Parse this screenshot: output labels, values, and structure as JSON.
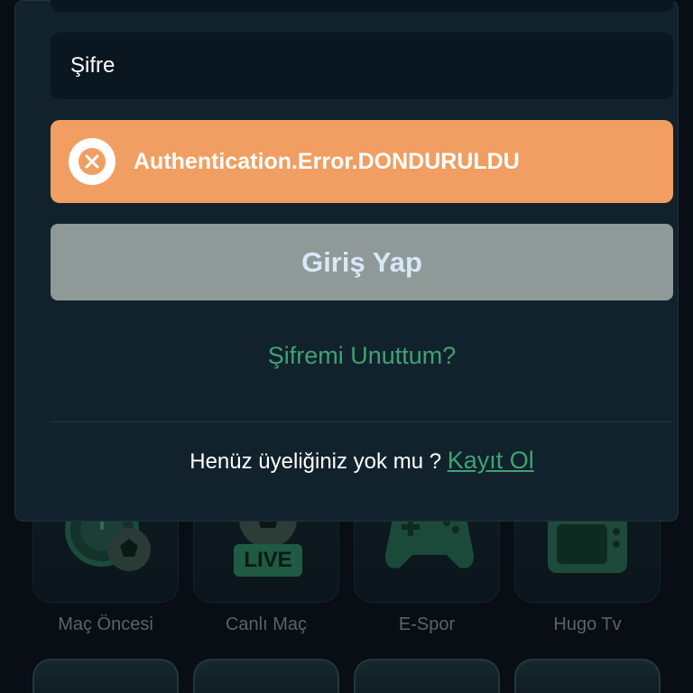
{
  "login": {
    "password_placeholder": "Şifre",
    "error_message": "Authentication.Error.DONDURULDU",
    "submit_label": "Giriş Yap",
    "forgot_label": "Şifremi Unuttum?",
    "signup_prompt": "Henüz üyeliğiniz yok mu ? ",
    "signup_link": "Kayıt Ol"
  },
  "categories": [
    {
      "label": "Maç Öncesi",
      "icon": "clock-ball-icon"
    },
    {
      "label": "Canlı Maç",
      "icon": "live-ball-icon",
      "badge": "LIVE"
    },
    {
      "label": "E-Spor",
      "icon": "gamepad-icon"
    },
    {
      "label": "Hugo Tv",
      "icon": "tv-icon"
    }
  ],
  "colors": {
    "alert": "#f09e62",
    "accent": "#3fa272",
    "button_disabled": "#8e9998",
    "modal_bg": "#11222d"
  }
}
